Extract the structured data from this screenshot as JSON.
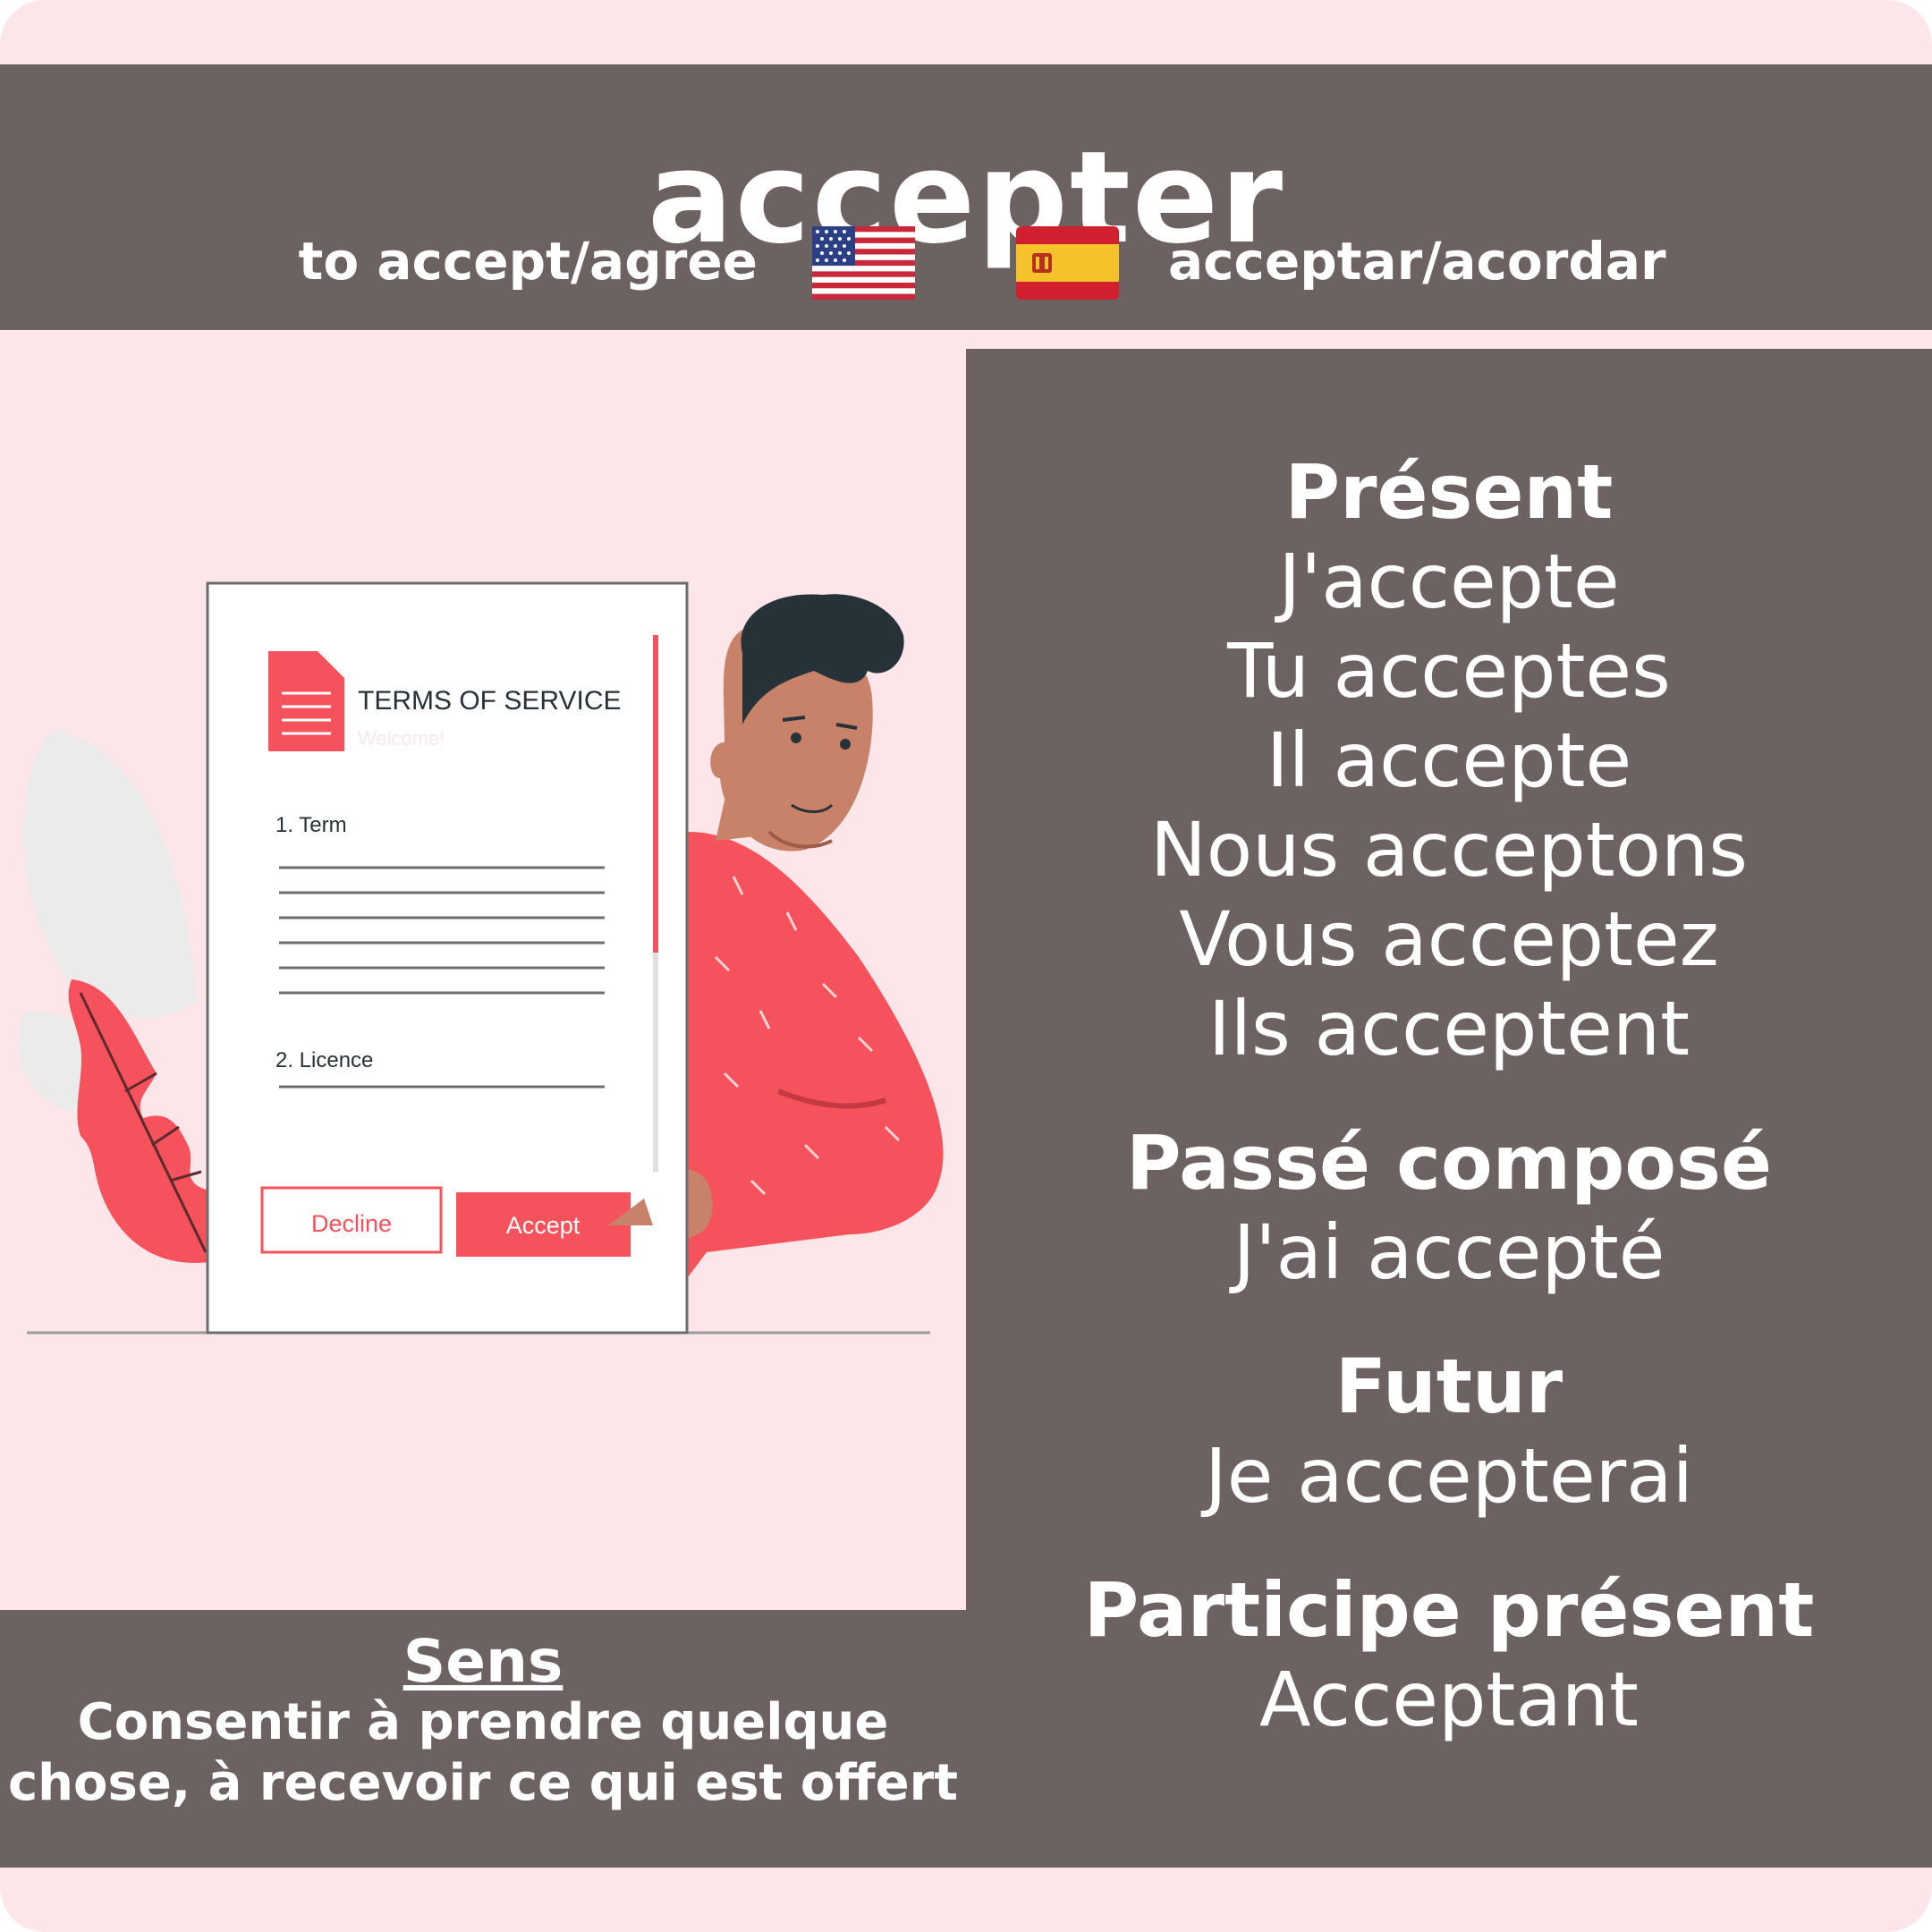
{
  "card": {
    "verb": "accepter",
    "english_translation": "to accept/agree",
    "spanish_translation": "acceptar/acordar",
    "flags": {
      "english": "us-flag-icon",
      "spanish": "spain-flag-icon"
    }
  },
  "illustration": {
    "document_title": "TERMS OF SERVICE",
    "document_subtitle": "Welcome!",
    "section_1": "1. Term",
    "section_2": "2. Licence",
    "decline_label": "Decline",
    "accept_label": "Accept"
  },
  "conjugations": {
    "present": {
      "heading": "Présent",
      "lines": [
        "J'accepte",
        "Tu acceptes",
        "Il accepte",
        "Nous acceptons",
        "Vous acceptez",
        "Ils acceptent"
      ]
    },
    "passe_compose": {
      "heading": "Passé composé",
      "lines": [
        "J'ai accepté"
      ]
    },
    "futur": {
      "heading": "Futur",
      "lines": [
        "Je accepterai"
      ]
    },
    "participe_present": {
      "heading": "Participe présent",
      "lines": [
        "Acceptant"
      ]
    }
  },
  "sens": {
    "heading": "Sens",
    "line_1": "Consentir à prendre quelque",
    "line_2": "chose, à recevoir ce qui est offert"
  },
  "colors": {
    "background": "#fde6e9",
    "panel": "#6c6262",
    "accent_red": "#f5525c",
    "text_light": "#ffffff"
  }
}
